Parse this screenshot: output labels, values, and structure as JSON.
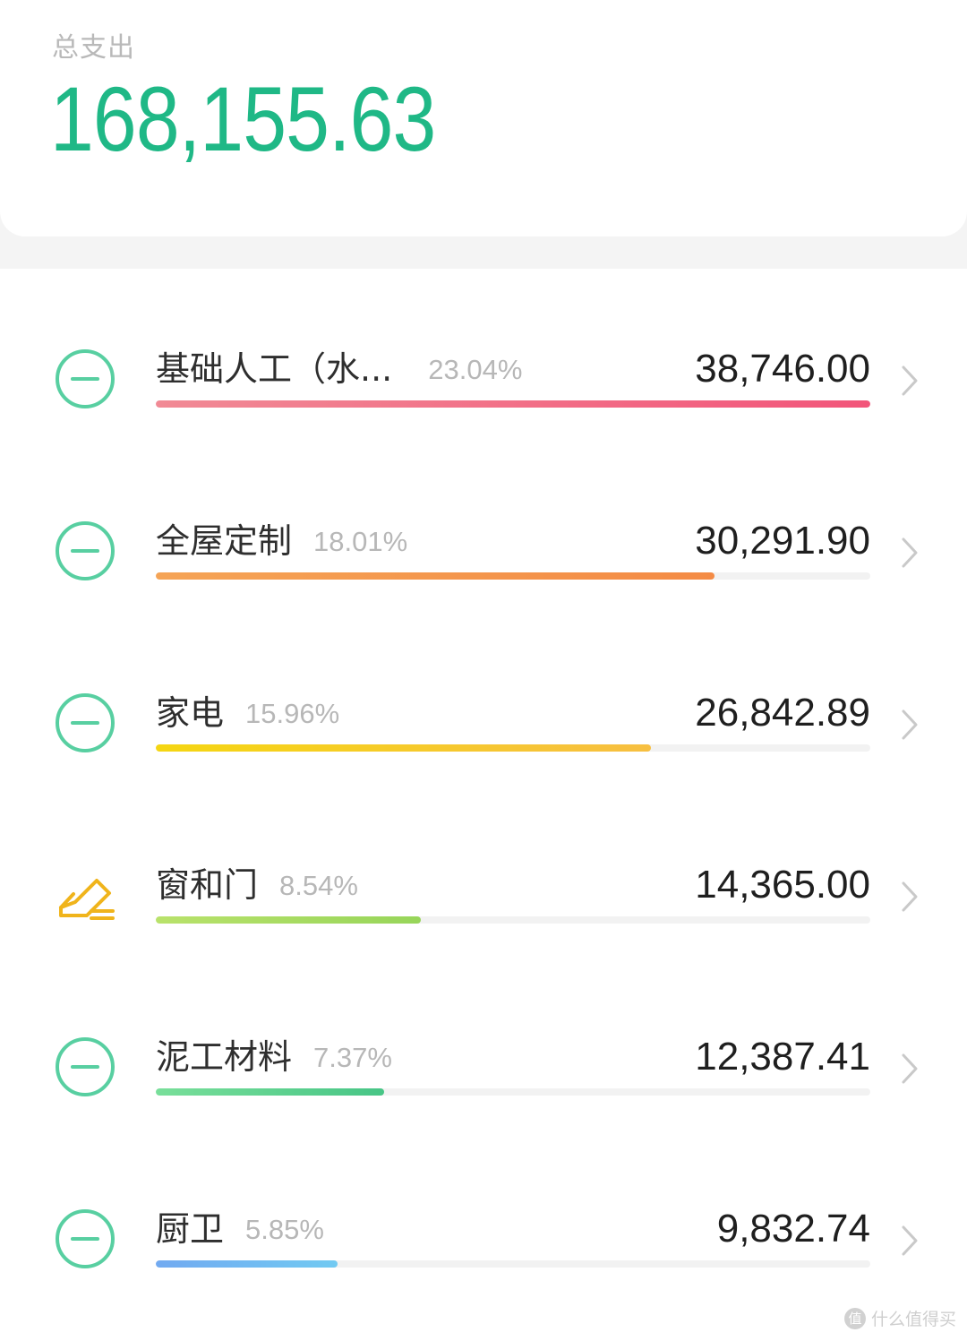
{
  "summary": {
    "label": "总支出",
    "total": "168,155.63"
  },
  "categories": [
    {
      "name": "基础人工（水...",
      "percent": "23.04%",
      "amount": "38,746.00",
      "bar_fill_fraction": 1.0,
      "bar_gradient": [
        "#f18a95",
        "#f2557a"
      ],
      "icon": "minus-circle-icon"
    },
    {
      "name": "全屋定制",
      "percent": "18.01%",
      "amount": "30,291.90",
      "bar_fill_fraction": 0.782,
      "bar_gradient": [
        "#f5a456",
        "#f48b45"
      ],
      "icon": "minus-circle-icon"
    },
    {
      "name": "家电",
      "percent": "15.96%",
      "amount": "26,842.89",
      "bar_fill_fraction": 0.693,
      "bar_gradient": [
        "#f5d612",
        "#f7bf41"
      ],
      "icon": "minus-circle-icon"
    },
    {
      "name": "窗和门",
      "percent": "8.54%",
      "amount": "14,365.00",
      "bar_fill_fraction": 0.371,
      "bar_gradient": [
        "#b9e26b",
        "#97d55a"
      ],
      "icon": "edit-pencil-icon"
    },
    {
      "name": "泥工材料",
      "percent": "7.37%",
      "amount": "12,387.41",
      "bar_fill_fraction": 0.32,
      "bar_gradient": [
        "#79df9a",
        "#47c586"
      ],
      "icon": "minus-circle-icon"
    },
    {
      "name": "厨卫",
      "percent": "5.85%",
      "amount": "9,832.74",
      "bar_fill_fraction": 0.254,
      "bar_gradient": [
        "#72aaf1",
        "#72caf2"
      ],
      "icon": "minus-circle-icon"
    }
  ],
  "colors": {
    "accent": "#1fb886",
    "icon_green": "#58cfa1",
    "icon_orange": "#f0b41b",
    "percent_gray": "#b7b7b7",
    "background": "#f4f4f4"
  },
  "watermark": {
    "logo": "值",
    "text": "什么值得买"
  }
}
